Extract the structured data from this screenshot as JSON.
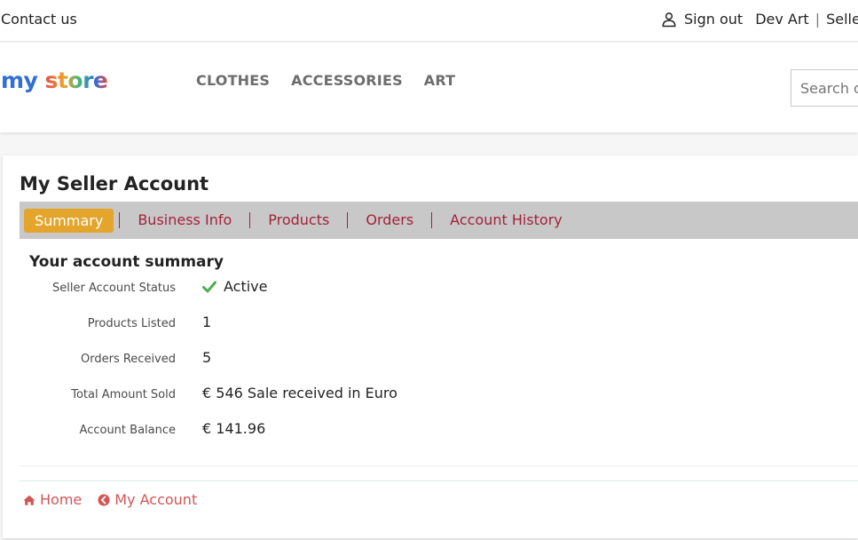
{
  "topbar": {
    "contact_label": "Contact us",
    "signout_label": "Sign out",
    "user_name": "Dev Art",
    "seller_label": "Seller",
    "user_icon": "user-icon"
  },
  "header": {
    "logo": {
      "part1": "my",
      "part2": "store"
    },
    "menu": [
      "CLOTHES",
      "ACCESSORIES",
      "ART"
    ],
    "search_placeholder": "Search our catalog"
  },
  "page": {
    "title": "My Seller Account",
    "tabs": [
      "Summary",
      "Business Info",
      "Products",
      "Orders",
      "Account History"
    ],
    "active_tab": "Summary",
    "summary_title": "Your account summary",
    "rows": [
      {
        "label": "Seller Account Status",
        "value": "Active",
        "icon": "check-icon"
      },
      {
        "label": "Products Listed",
        "value": "1"
      },
      {
        "label": "Orders Received",
        "value": "5"
      },
      {
        "label": "Total Amount Sold",
        "value": "€ 546 Sale received in Euro"
      },
      {
        "label": "Account Balance",
        "value": "€ 141.96"
      }
    ]
  },
  "footer": {
    "home_label": "Home",
    "home_icon": "home-icon",
    "account_label": "My Account",
    "account_icon": "chevron-left-circle-icon"
  },
  "colors": {
    "accent_tab": "#e3a52c",
    "tab_text": "#a3223a",
    "footer_link": "#d35556",
    "status_ok": "#4caf50"
  }
}
